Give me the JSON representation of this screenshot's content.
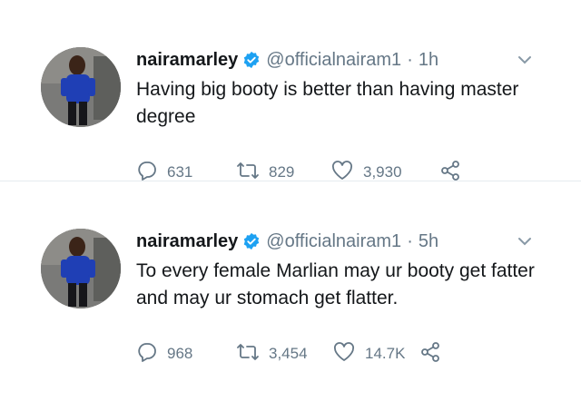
{
  "tweets": [
    {
      "display_name": "nairamarley",
      "handle": "@officialnairam1",
      "separator": "·",
      "time": "1h",
      "text": "Having big booty is better than having master degree",
      "replies": "631",
      "retweets": "829",
      "likes": "3,930"
    },
    {
      "display_name": "nairamarley",
      "handle": "@officialnairam1",
      "separator": "·",
      "time": "5h",
      "text": "To every female Marlian may ur booty get fatter and may ur stomach get flatter.",
      "replies": "968",
      "retweets": "3,454",
      "likes": "14.7K"
    }
  ],
  "icons": {
    "verified": "verified-badge-icon",
    "caret": "chevron-down-icon",
    "reply": "reply-icon",
    "retweet": "retweet-icon",
    "like": "heart-icon",
    "share": "share-icon"
  },
  "colors": {
    "verified_blue": "#1da1f2",
    "secondary_text": "#657786",
    "primary_text": "#14171a"
  }
}
